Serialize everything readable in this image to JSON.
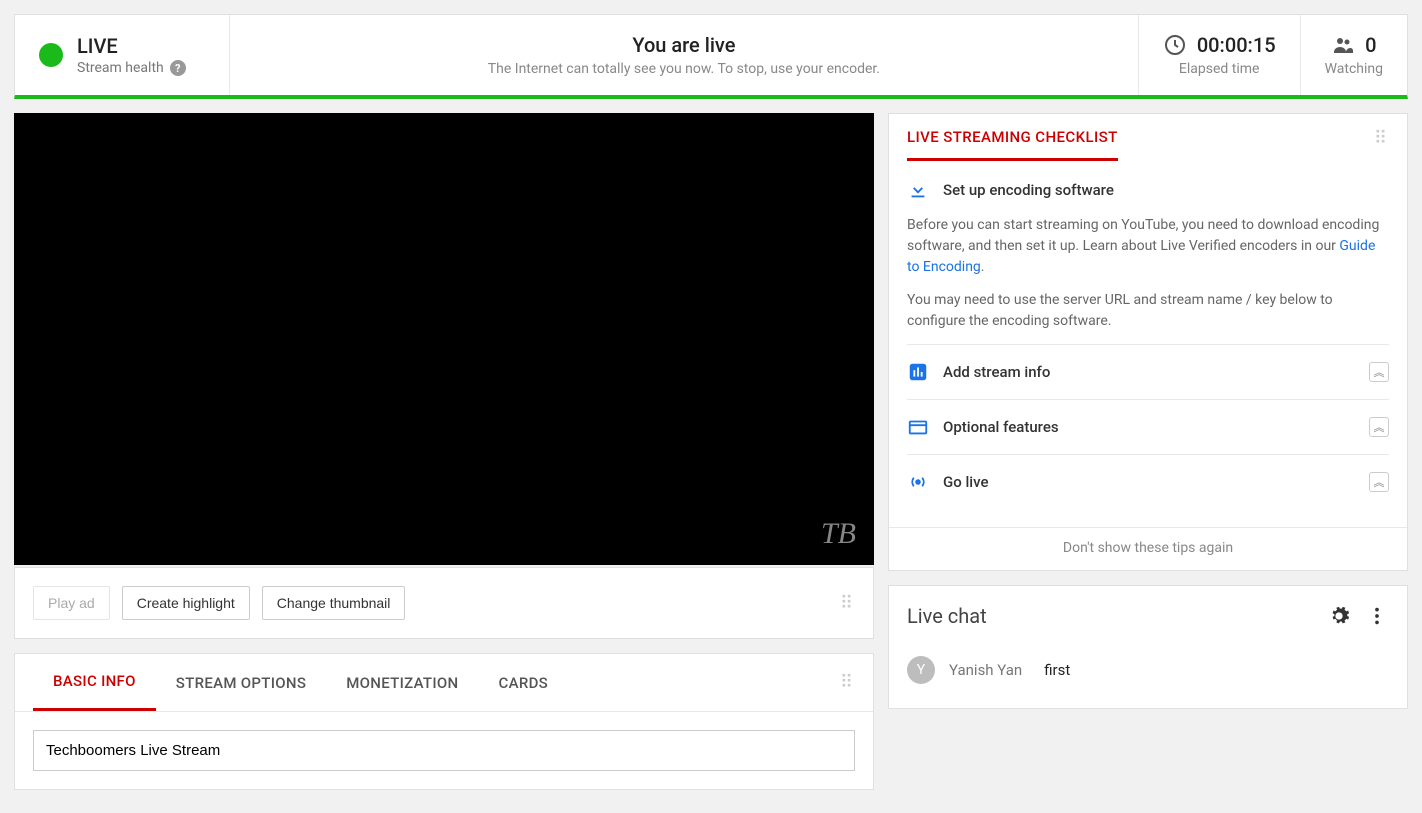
{
  "status": {
    "live_label": "LIVE",
    "stream_health_label": "Stream health",
    "center_title": "You are live",
    "center_text": "The Internet can totally see you now. To stop, use your encoder.",
    "elapsed_value": "00:00:15",
    "elapsed_label": "Elapsed time",
    "watching_value": "0",
    "watching_label": "Watching"
  },
  "watermark": "TB",
  "actions": {
    "play_ad": "Play ad",
    "create_highlight": "Create highlight",
    "change_thumbnail": "Change thumbnail"
  },
  "tabs": {
    "basic_info": "BASIC INFO",
    "stream_options": "STREAM OPTIONS",
    "monetization": "MONETIZATION",
    "cards": "CARDS"
  },
  "stream_title_value": "Techboomers Live Stream",
  "checklist": {
    "title": "LIVE STREAMING CHECKLIST",
    "item1_title": "Set up encoding software",
    "item1_desc1a": "Before you can start streaming on YouTube, you need to download encoding software, and then set it up. Learn about Live Verified encoders in our ",
    "item1_link": "Guide to Encoding",
    "item1_desc1b": ".",
    "item1_desc2": "You may need to use the server URL and stream name / key below to configure the encoding software.",
    "item2": "Add stream info",
    "item3": "Optional features",
    "item4": "Go live",
    "dont_show": "Don't show these tips again"
  },
  "chat": {
    "title": "Live chat",
    "msg_user": "Yanish Yan",
    "msg_text": "first",
    "avatar_letter": "Y"
  }
}
